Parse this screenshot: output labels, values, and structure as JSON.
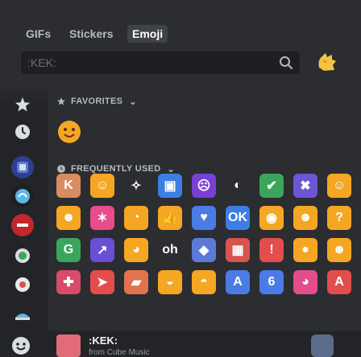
{
  "tabs": [
    {
      "label": "GIFs",
      "active": false
    },
    {
      "label": "Stickers",
      "active": false
    },
    {
      "label": "Emoji",
      "active": true
    }
  ],
  "search": {
    "placeholder": ":KEK:",
    "icon": "search-icon"
  },
  "categories": {
    "favorites": "FAVORITES",
    "frequently_used": "FREQUENTLY USED"
  },
  "sidebar": {
    "items": [
      "star-icon",
      "clock-icon",
      "server-icon",
      "server-icon",
      "server-icon",
      "server-icon",
      "server-icon",
      "server-icon",
      "server-icon"
    ]
  },
  "frequently_used_emojis": [
    {
      "name": "kek-cat",
      "color": "#d98c5f",
      "glyph": "K"
    },
    {
      "name": "smile",
      "color": "#f5a623",
      "glyph": "☺"
    },
    {
      "name": "sparkle",
      "color": "#2b2d31",
      "glyph": "✧"
    },
    {
      "name": "square",
      "color": "#3d7ee6",
      "glyph": "▣"
    },
    {
      "name": "purple-face",
      "color": "#7a3fd6",
      "glyph": "☹"
    },
    {
      "name": "dark-face",
      "color": "#2b2d31",
      "glyph": "◐"
    },
    {
      "name": "check",
      "color": "#3ba55c",
      "glyph": "✔"
    },
    {
      "name": "cross",
      "color": "#6d55d6",
      "glyph": "✖"
    },
    {
      "name": "blush",
      "color": "#f5a623",
      "glyph": "☺"
    },
    {
      "name": "grin",
      "color": "#f5a623",
      "glyph": "☻"
    },
    {
      "name": "party",
      "color": "#e94c8b",
      "glyph": "✶"
    },
    {
      "name": "mouth",
      "color": "#f5a623",
      "glyph": "◔"
    },
    {
      "name": "thumbs",
      "color": "#f5a623",
      "glyph": "👍"
    },
    {
      "name": "heart-blue",
      "color": "#4b7be5",
      "glyph": "♥"
    },
    {
      "name": "ok",
      "color": "#3d7ee6",
      "glyph": "OK"
    },
    {
      "name": "eyes",
      "color": "#f5a623",
      "glyph": "◉"
    },
    {
      "name": "sweat",
      "color": "#f5a623",
      "glyph": "☻"
    },
    {
      "name": "think",
      "color": "#f5a623",
      "glyph": "?"
    },
    {
      "name": "green-box",
      "color": "#3ba55c",
      "glyph": "G"
    },
    {
      "name": "chart",
      "color": "#6a4fd6",
      "glyph": "↗"
    },
    {
      "name": "yawn",
      "color": "#f5a623",
      "glyph": "◕"
    },
    {
      "name": "oh",
      "color": "#2b2d31",
      "glyph": "oh"
    },
    {
      "name": "blue-cat",
      "color": "#5d7ad8",
      "glyph": "◆"
    },
    {
      "name": "gift",
      "color": "#d9534f",
      "glyph": "▦"
    },
    {
      "name": "warning",
      "color": "#e24d4d",
      "glyph": "!"
    },
    {
      "name": "clown",
      "color": "#f5a623",
      "glyph": "●"
    },
    {
      "name": "blob",
      "color": "#f5a623",
      "glyph": "☻"
    },
    {
      "name": "pepe",
      "color": "#d94b6a",
      "glyph": "✚"
    },
    {
      "name": "arrow",
      "color": "#e24d4d",
      "glyph": "➤"
    },
    {
      "name": "box-art",
      "color": "#e2734d",
      "glyph": "▰"
    },
    {
      "name": "smug",
      "color": "#f5a623",
      "glyph": "◒"
    },
    {
      "name": "joy",
      "color": "#f5a623",
      "glyph": "◓"
    },
    {
      "name": "boxed-a",
      "color": "#4b7be5",
      "glyph": "A"
    },
    {
      "name": "six",
      "color": "#4b7be5",
      "glyph": "6"
    },
    {
      "name": "pink-face",
      "color": "#e24d8b",
      "glyph": "◕"
    },
    {
      "name": "red-a",
      "color": "#e24d4d",
      "glyph": "A"
    }
  ],
  "footer": {
    "emoji_name": ":KEK:",
    "from_text": "from Cube Music"
  }
}
